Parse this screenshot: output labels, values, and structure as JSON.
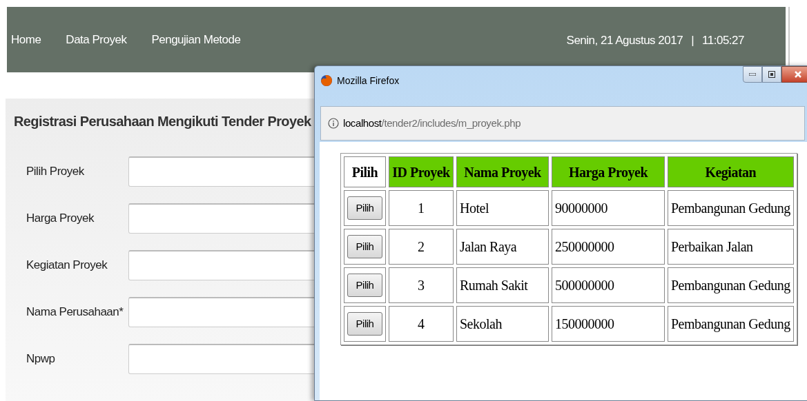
{
  "nav": {
    "items": [
      "Home",
      "Data Proyek",
      "Pengujian Metode"
    ],
    "date": "Senin, 21 Agustus 2017",
    "separator": "|",
    "time": "11:05:27"
  },
  "form": {
    "title": "Registrasi Perusahaan Mengikuti Tender Proyek",
    "fields": [
      {
        "label": "Pilih Proyek"
      },
      {
        "label": "Harga Proyek"
      },
      {
        "label": "Kegiatan Proyek"
      },
      {
        "label": "Nama Perusahaan*"
      },
      {
        "label": "Npwp"
      }
    ]
  },
  "popup": {
    "title": "Mozilla Firefox",
    "url_host": "localhost",
    "url_path": "/tender2/includes/m_proyek.php",
    "table": {
      "columns": [
        {
          "label": "Pilih",
          "highlighted": false
        },
        {
          "label": "ID Proyek",
          "highlighted": true
        },
        {
          "label": "Nama Proyek",
          "highlighted": true
        },
        {
          "label": "Harga Proyek",
          "highlighted": true
        },
        {
          "label": "Kegiatan",
          "highlighted": true
        }
      ],
      "rows": [
        {
          "button": "Pilih",
          "id": "1",
          "nama": "Hotel",
          "harga": "90000000",
          "kegiatan": "Pembangunan Gedung"
        },
        {
          "button": "Pilih",
          "id": "2",
          "nama": "Jalan Raya",
          "harga": "250000000",
          "kegiatan": "Perbaikan Jalan"
        },
        {
          "button": "Pilih",
          "id": "3",
          "nama": "Rumah Sakit",
          "harga": "500000000",
          "kegiatan": "Pembangunan Gedung"
        },
        {
          "button": "Pilih",
          "id": "4",
          "nama": "Sekolah",
          "harga": "150000000",
          "kegiatan": "Pembangunan Gedung"
        }
      ]
    }
  }
}
